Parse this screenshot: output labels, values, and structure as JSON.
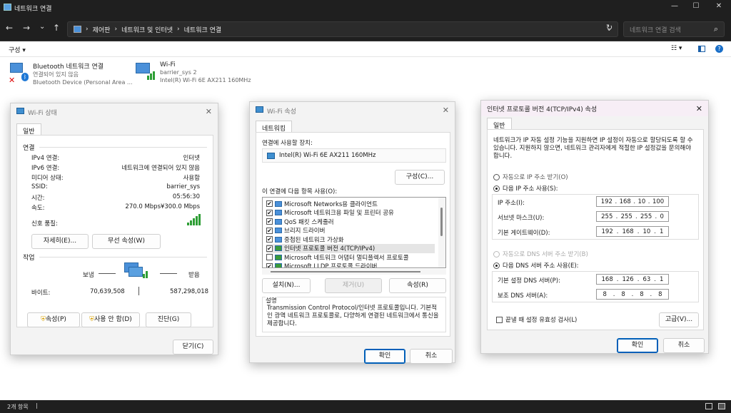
{
  "window": {
    "title": "네트워크 연결",
    "min": "—",
    "max": "☐",
    "close": "✕"
  },
  "nav": {
    "back": "←",
    "forward": "→",
    "down": "⌄",
    "up": "↑",
    "breadcrumb": [
      "제어판",
      "네트워크 및 인터넷",
      "네트워크 연결"
    ],
    "sep": "›",
    "dropdown": "⌄",
    "refresh": "↻",
    "search_placeholder": "네트워크 연결 검색",
    "search_icon": "⌕"
  },
  "cmd": {
    "organize": "구성 ▾",
    "view": "☷ ▾"
  },
  "connections": [
    {
      "name": "Bluetooth 네트워크 연결",
      "status": "연결되어 있지 않음",
      "device": "Bluetooth Device (Personal Area ..."
    },
    {
      "name": "Wi-Fi",
      "status": "barrier_sys 2",
      "device": "Intel(R) Wi-Fi 6E AX211 160MHz"
    }
  ],
  "status": {
    "count": "2개 항목",
    "sep": "|"
  },
  "wifi_status": {
    "title": "Wi-Fi 상태",
    "tab": "일반",
    "sec_conn": "연결",
    "rows": [
      {
        "k": "IPv4 연결:",
        "v": "인터넷"
      },
      {
        "k": "IPv6 연결:",
        "v": "네트워크에 연결되어 있지 않음"
      },
      {
        "k": "미디어 상태:",
        "v": "사용함"
      },
      {
        "k": "SSID:",
        "v": "barrier_sys"
      },
      {
        "k": "시간:",
        "v": "05:56:30"
      },
      {
        "k": "속도:",
        "v": "270.0 Mbps¥300.0 Mbps"
      }
    ],
    "signal": "신호 품질:",
    "details": "자세히(E)...",
    "wireless": "무선 속성(W)",
    "sec_act": "작업",
    "sent": "보냄",
    "recv": "받음",
    "bytes": "바이트:",
    "sent_v": "70,639,508",
    "recv_v": "587,298,018",
    "props": "속성(P)",
    "disable": "사용 안 함(D)",
    "diag": "진단(G)",
    "close": "닫기(C)"
  },
  "wifi_props": {
    "title": "Wi-Fi 속성",
    "tab": "네트워킹",
    "connect_using": "연결에 사용할 장치:",
    "adapter": "Intel(R) Wi-Fi 6E AX211 160MHz",
    "configure": "구성(C)...",
    "items_label": "이 연결에 다음 항목 사용(O):",
    "items": [
      {
        "label": "Microsoft Networks용 클라이언트",
        "checked": "✔"
      },
      {
        "label": "Microsoft 네트워크용 파일 및 프린터 공유",
        "checked": "✔"
      },
      {
        "label": "QoS 패킷 스케줄러",
        "checked": "✔"
      },
      {
        "label": "브리지 드라이버",
        "checked": "✔"
      },
      {
        "label": "중첩된 네트워크 가상화",
        "checked": "✔"
      },
      {
        "label": "인터넷 프로토콜 버전 4(TCP/IPv4)",
        "checked": "✔"
      },
      {
        "label": "Microsoft 네트워크 어댑터 멀티플렉서 프로토콜",
        "checked": ""
      },
      {
        "label": "Microsoft LLDP 프로토콜 드라이버",
        "checked": "✔"
      }
    ],
    "install": "설치(N)...",
    "uninstall": "제거(U)",
    "properties": "속성(R)",
    "desc_title": "설명",
    "desc": "Transmission Control Protocol/인터넷 프로토콜입니다. 기본적인 광역 네트워크 프로토콜로, 다양하게 연결된 네트워크에서 통신을 제공합니다.",
    "ok": "확인",
    "cancel": "취소"
  },
  "ipv4": {
    "title": "인터넷 프로토콜 버전 4(TCP/IPv4) 속성",
    "tab": "일반",
    "intro": "네트워크가 IP 자동 설정 기능을 지원하면 IP 설정이 자동으로 할당되도록 할 수 있습니다. 지원하지 않으면, 네트워크 관리자에게 적절한 IP 설정값을 문의해야 합니다.",
    "auto_ip": "자동으로 IP 주소 받기(O)",
    "manual_ip": "다음 IP 주소 사용(S):",
    "ip_label": "IP 주소(I):",
    "ip": [
      "192",
      "168",
      "10",
      "100"
    ],
    "mask_label": "서브넷 마스크(U):",
    "mask": [
      "255",
      "255",
      "255",
      "0"
    ],
    "gw_label": "기본 게이트웨이(D):",
    "gw": [
      "192",
      "168",
      "10",
      "1"
    ],
    "auto_dns": "자동으로 DNS 서버 주소 받기(B)",
    "manual_dns": "다음 DNS 서버 주소 사용(E):",
    "dns1_label": "기본 설정 DNS 서버(P):",
    "dns1": [
      "168",
      "126",
      "63",
      "1"
    ],
    "dns2_label": "보조 DNS 서버(A):",
    "dns2": [
      "8",
      "8",
      "8",
      "8"
    ],
    "validate": "끝낼 때 설정 유효성 검사(L)",
    "advanced": "고급(V)...",
    "ok": "확인",
    "cancel": "취소"
  },
  "colors": {
    "accent": "#005fb8",
    "dark": "#1f1f1f",
    "signal": "#2e9e35"
  }
}
